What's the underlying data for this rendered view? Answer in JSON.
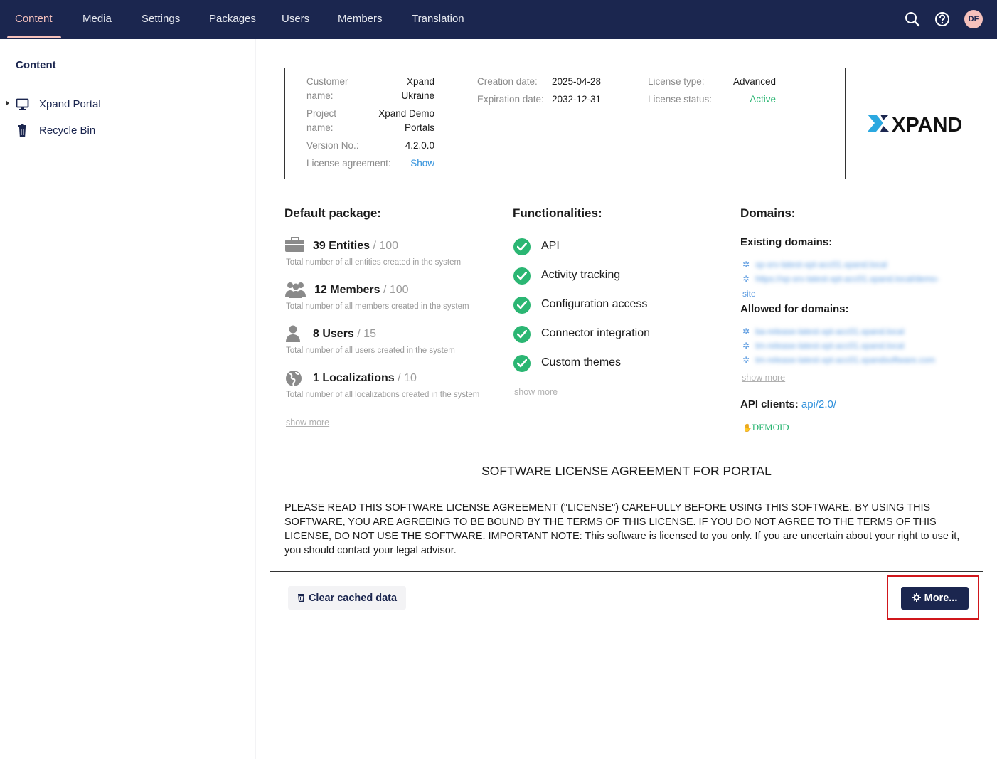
{
  "nav": {
    "items": [
      {
        "label": "Content",
        "active": true
      },
      {
        "label": "Media"
      },
      {
        "label": "Settings"
      },
      {
        "label": "Packages"
      },
      {
        "label": "Users"
      },
      {
        "label": "Members"
      },
      {
        "label": "Translation"
      }
    ],
    "icons": [
      "search-icon",
      "help-icon"
    ],
    "avatar_initials": "DF"
  },
  "sidebar": {
    "title": "Content",
    "items": [
      {
        "label": "Xpand Portal",
        "icon": "monitor-icon",
        "expandable": true
      },
      {
        "label": "Recycle Bin",
        "icon": "trash-icon"
      }
    ]
  },
  "license": {
    "customer_name_label": "Customer name:",
    "customer_name_label_1": "Customer",
    "customer_name_label_2": "name:",
    "customer_name_1": "Xpand",
    "customer_name_2": "Ukraine",
    "project_name_label_1": "Project",
    "project_name_label_2": "name:",
    "project_name_1": "Xpand Demo",
    "project_name_2": "Portals",
    "version_label": "Version No.:",
    "version": "4.2.0.0",
    "agreement_label": "License agreement:",
    "agreement_link": "Show",
    "creation_label": "Creation date:",
    "creation_date": "2025-04-28",
    "expiration_label": "Expiration date:",
    "expiration_date": "2032-12-31",
    "type_label": "License type:",
    "type": "Advanced",
    "status_label": "License status:",
    "status": "Active"
  },
  "logo_text": "XPAND",
  "package": {
    "title": "Default package:",
    "items": [
      {
        "count": "39 Entities",
        "limit": "/ 100",
        "desc": "Total number of all entities created in the system",
        "icon": "briefcase-icon"
      },
      {
        "count": "12 Members",
        "limit": "/ 100",
        "desc": "Total number of all members created in the system",
        "icon": "members-icon"
      },
      {
        "count": "8 Users",
        "limit": "/ 15",
        "desc": "Total number of all users created in the system",
        "icon": "user-icon"
      },
      {
        "count": "1 Localizations",
        "limit": "/ 10",
        "desc": "Total number of all localizations created in the system",
        "icon": "globe-icon"
      }
    ],
    "show_more": "show more"
  },
  "functionalities": {
    "title": "Functionalities:",
    "items": [
      "API",
      "Activity tracking",
      "Configuration access",
      "Connector integration",
      "Custom themes"
    ],
    "show_more": "show more"
  },
  "domains": {
    "title": "Domains:",
    "existing_title": "Existing domains:",
    "existing": [
      "xp-srv-latest-xpt-acc01.xpand.local",
      "https://xp-srv-latest-xpt-acc01.xpand.local/demo-"
    ],
    "existing_cont": "site",
    "allowed_title": "Allowed for domains:",
    "allowed": [
      "ba-release-latest-xpt-acc01.xpand.local",
      "tm-release-latest-xpt-acc01.xpand.local",
      "tm-release-latest-xpt-acc01.xpandsoftware.com"
    ],
    "show_more": "show more",
    "api_label": "API clients:",
    "api_link": "api/2.0/",
    "api_client": "DEMOID"
  },
  "agreement": {
    "title": "SOFTWARE LICENSE AGREEMENT FOR PORTAL",
    "text": "PLEASE READ THIS SOFTWARE LICENSE AGREEMENT (\"LICENSE\") CAREFULLY BEFORE USING THIS SOFTWARE. BY USING THIS SOFTWARE, YOU ARE AGREEING TO BE BOUND BY THE TERMS OF THIS LICENSE. IF YOU DO NOT AGREE TO THE TERMS OF THIS LICENSE, DO NOT USE THE SOFTWARE. IMPORTANT NOTE: This software is licensed to you only. If you are uncertain about your right to use it, you should contact your legal advisor."
  },
  "actions": {
    "clear_cache": "Clear cached data",
    "more": "More..."
  },
  "colors": {
    "nav_bg": "#1b264f",
    "accent": "#f5c1bc",
    "success": "#2bb673",
    "link": "#2d8fdb",
    "highlight": "#d0161b"
  }
}
